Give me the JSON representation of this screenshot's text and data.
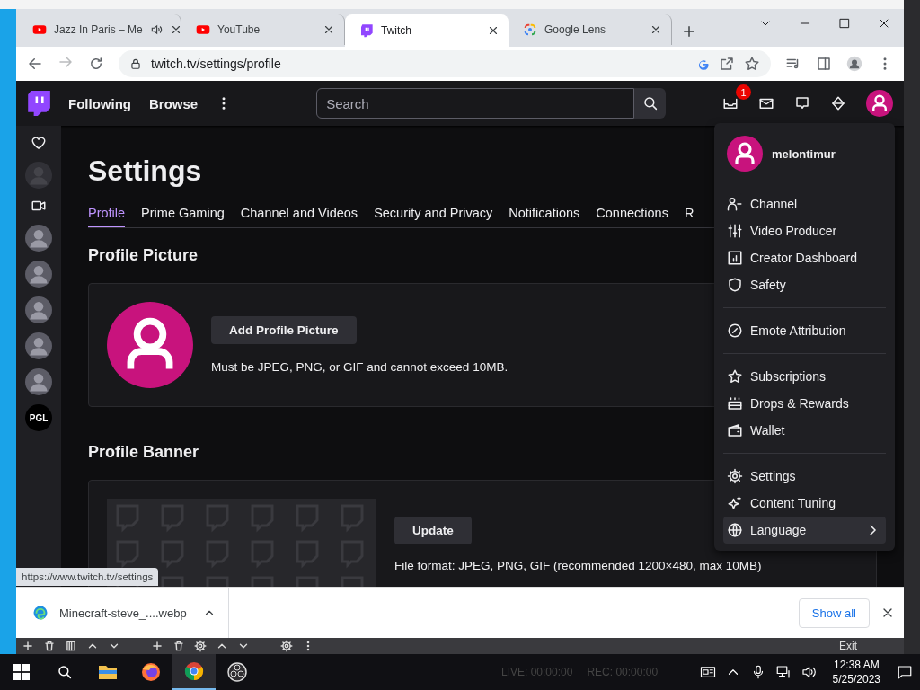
{
  "browser": {
    "tabs": [
      {
        "kind": "youtube",
        "title": "Jazz In Paris – Me",
        "audio": true,
        "selected": false
      },
      {
        "kind": "youtube",
        "title": "YouTube",
        "audio": false,
        "selected": false
      },
      {
        "kind": "twitch",
        "title": "Twitch",
        "audio": false,
        "selected": true
      },
      {
        "kind": "lens",
        "title": "Google Lens",
        "audio": false,
        "selected": false
      }
    ],
    "address": "twitch.tv/settings/profile",
    "status_url": "https://www.twitch.tv/settings"
  },
  "twitch": {
    "nav": {
      "links": [
        "Following",
        "Browse"
      ],
      "search": {
        "placeholder": "Search"
      },
      "notification_count": "1"
    },
    "sidebar": [
      {
        "kind": "heart"
      },
      {
        "kind": "avatar",
        "dimmed": true
      },
      {
        "kind": "camera"
      },
      {
        "kind": "avatar",
        "dimmed": false
      },
      {
        "kind": "avatar",
        "dimmed": false
      },
      {
        "kind": "avatar",
        "dimmed": false
      },
      {
        "kind": "avatar",
        "dimmed": false
      },
      {
        "kind": "avatar",
        "dimmed": false
      },
      {
        "kind": "logo",
        "text": "PGL"
      }
    ],
    "title": "Settings",
    "tabs": [
      {
        "label": "Profile",
        "selected": true
      },
      {
        "label": "Prime Gaming",
        "selected": false
      },
      {
        "label": "Channel and Videos",
        "selected": false
      },
      {
        "label": "Security and Privacy",
        "selected": false
      },
      {
        "label": "Notifications",
        "selected": false
      },
      {
        "label": "Connections",
        "selected": false
      },
      {
        "label": "R",
        "selected": false
      }
    ],
    "profile_picture": {
      "heading": "Profile Picture",
      "button": "Add Profile Picture",
      "hint": "Must be JPEG, PNG, or GIF and cannot exceed 10MB."
    },
    "profile_banner": {
      "heading": "Profile Banner",
      "button": "Update",
      "hint": "File format: JPEG, PNG, GIF (recommended 1200×480, max 10MB)"
    },
    "menu": {
      "username": "melontimur",
      "groups": [
        {
          "items": [
            {
              "kind": "channel",
              "label": "Channel",
              "hovered": false,
              "submenu": false
            },
            {
              "kind": "producer",
              "label": "Video Producer",
              "hovered": false,
              "submenu": false
            },
            {
              "kind": "dashboard",
              "label": "Creator Dashboard",
              "hovered": false,
              "submenu": false
            },
            {
              "kind": "safety",
              "label": "Safety",
              "hovered": false,
              "submenu": false
            }
          ]
        },
        {
          "items": [
            {
              "kind": "emote",
              "label": "Emote Attribution",
              "hovered": false,
              "submenu": false
            }
          ]
        },
        {
          "items": [
            {
              "kind": "star",
              "label": "Subscriptions",
              "hovered": false,
              "submenu": false
            },
            {
              "kind": "drops",
              "label": "Drops & Rewards",
              "hovered": false,
              "submenu": false
            },
            {
              "kind": "wallet",
              "label": "Wallet",
              "hovered": false,
              "submenu": false
            }
          ]
        },
        {
          "items": [
            {
              "kind": "gear",
              "label": "Settings",
              "hovered": false,
              "submenu": false
            },
            {
              "kind": "sparkle",
              "label": "Content Tuning",
              "hovered": false,
              "submenu": false
            },
            {
              "kind": "globe",
              "label": "Language",
              "hovered": true,
              "submenu": true
            }
          ]
        }
      ]
    }
  },
  "downloads": {
    "file": "Minecraft-steve_....webp",
    "show_all": "Show all"
  },
  "obs": {
    "exit": "Exit",
    "live": "LIVE: 00:00:00",
    "rec": "REC: 00:00:00"
  },
  "taskbar": {
    "apps": [
      {
        "kind": "explorer",
        "active": false
      },
      {
        "kind": "firefox",
        "active": false
      },
      {
        "kind": "chrome",
        "active": true
      },
      {
        "kind": "obs",
        "active": false
      }
    ],
    "time": "12:38 AM",
    "date": "5/25/2023"
  }
}
